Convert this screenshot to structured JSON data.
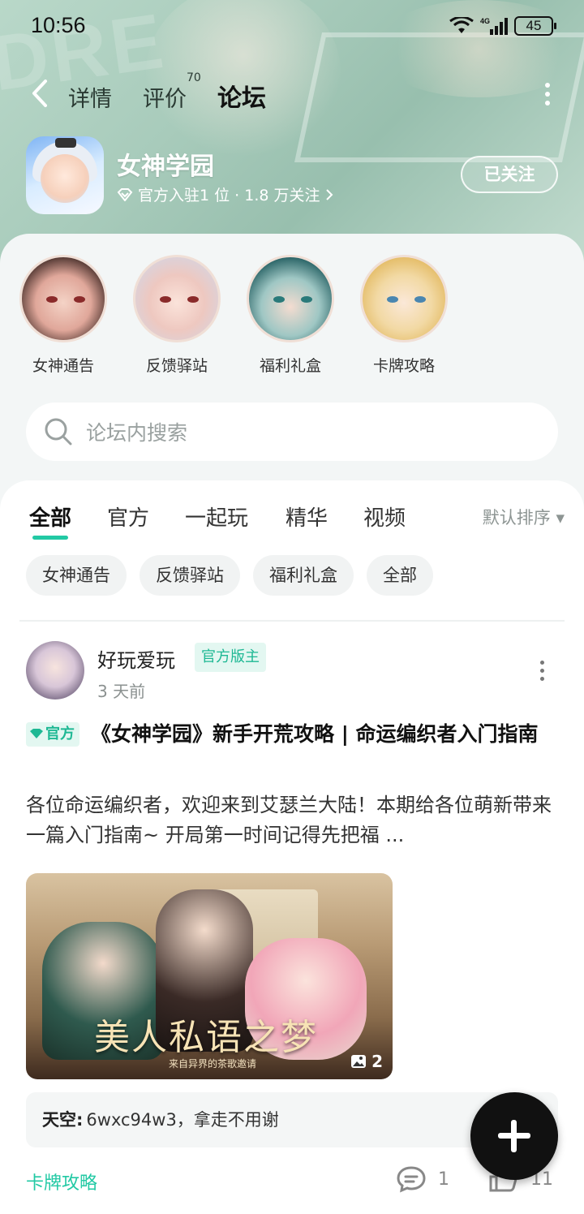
{
  "status_bar": {
    "time": "10:56",
    "network": "4G",
    "battery": "45"
  },
  "nav": {
    "tabs": [
      {
        "label": "详情"
      },
      {
        "label": "评价",
        "badge": "70"
      },
      {
        "label": "论坛"
      }
    ],
    "active_tab": "论坛"
  },
  "app": {
    "name": "女神学园",
    "meta": "官方入驻1 位 · 1.8 万关注",
    "follow_label": "已关注"
  },
  "circles": [
    {
      "label": "女神通告"
    },
    {
      "label": "反馈驿站"
    },
    {
      "label": "福利礼盒"
    },
    {
      "label": "卡牌攻略"
    }
  ],
  "search": {
    "placeholder": "论坛内搜索"
  },
  "filter_tabs": [
    "全部",
    "官方",
    "一起玩",
    "精华",
    "视频"
  ],
  "sort_label": "默认排序",
  "chips": [
    "女神通告",
    "反馈驿站",
    "福利礼盒",
    "全部"
  ],
  "post": {
    "author": "好玩爱玩",
    "author_badge": "官方版主",
    "time": "3 天前",
    "official_tag": "官方",
    "title": "《女神学园》新手开荒攻略 | 命运编织者入门指南",
    "excerpt": "各位命运编织者，欢迎来到艾瑟兰大陆！本期给各位萌新带来一篇入门指南~ 开局第一时间记得先把福 ...",
    "image_caption": "美人私语之梦",
    "image_subcaption": "来自异界的茶歌邀请",
    "image_count": "2",
    "comment_user": "天空:",
    "comment_text": "6wxc94w3，拿走不用谢",
    "category": "卡牌攻略",
    "comments": "1",
    "likes": "11"
  },
  "colors": {
    "accent": "#22c9a4",
    "hero_bg": "#a8cbbb",
    "fab": "#111111"
  }
}
